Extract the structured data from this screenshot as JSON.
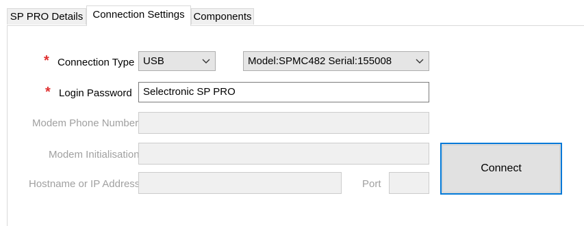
{
  "tabs": [
    {
      "label": "SP PRO Details",
      "active": false
    },
    {
      "label": "Connection Settings",
      "active": true
    },
    {
      "label": "Components",
      "active": false
    }
  ],
  "form": {
    "required_marker": "*",
    "connection_type": {
      "label": "Connection Type",
      "value": "USB",
      "device_value": "Model:SPMC482 Serial:155008"
    },
    "login_password": {
      "label": "Login Password",
      "value": "Selectronic SP PRO"
    },
    "modem_phone": {
      "label": "Modem Phone Number",
      "value": ""
    },
    "modem_init": {
      "label": "Modem Initialisation",
      "value": ""
    },
    "hostname": {
      "label": "Hostname or IP Address",
      "value": ""
    },
    "port": {
      "label": "Port",
      "value": ""
    }
  },
  "connect_button": {
    "label": "Connect"
  },
  "colors": {
    "required_marker": "#e03030",
    "button_focus_border": "#0078d7",
    "disabled_text": "#a0a0a0"
  }
}
